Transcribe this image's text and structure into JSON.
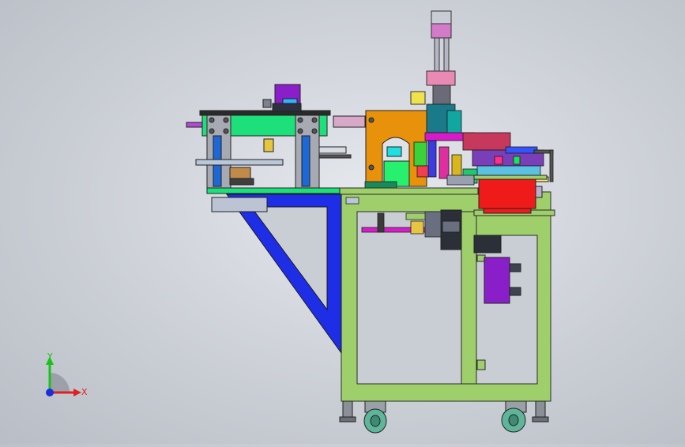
{
  "app": {
    "title": ""
  },
  "triad": {
    "y_label": "Y",
    "x_label": "X",
    "y_color": "#19c419",
    "x_color": "#e02020",
    "z_color": "#1a2ee0"
  },
  "model": {
    "description_parts": [
      "frame",
      "diagonal-brace",
      "left-conveyor-module",
      "press-head",
      "vertical-column",
      "control-box",
      "motor-unit",
      "caster-wheels"
    ],
    "colors": {
      "frame": "#9fcf6a",
      "brace": "#1e2ee6",
      "plate": "#1ee07a",
      "press": "#e8920c",
      "control_box": "#ef1b1b",
      "motor": "#8a1fc9",
      "column": "#b6b6c4"
    }
  }
}
